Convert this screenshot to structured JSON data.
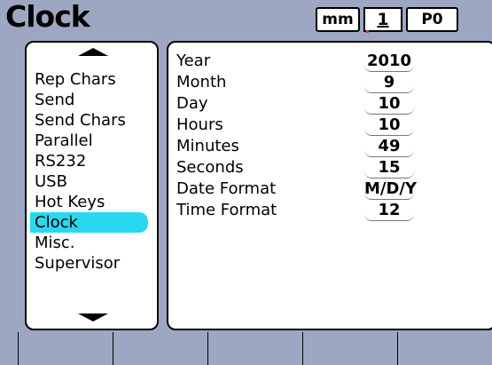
{
  "header": {
    "title": "Clock",
    "units": "mm",
    "channel": "1",
    "preset": "P0"
  },
  "menu": {
    "items": [
      {
        "label": "Rep  Chars"
      },
      {
        "label": "Send"
      },
      {
        "label": "Send  Chars"
      },
      {
        "label": "Parallel"
      },
      {
        "label": "RS232"
      },
      {
        "label": "USB"
      },
      {
        "label": "Hot  Keys"
      },
      {
        "label": "Clock",
        "selected": true
      },
      {
        "label": "Misc."
      },
      {
        "label": "Supervisor"
      }
    ],
    "selected_color": "#29d8ee"
  },
  "settings": {
    "rows": [
      {
        "label": "Year",
        "value": "2010"
      },
      {
        "label": "Month",
        "value": "9"
      },
      {
        "label": "Day",
        "value": "10"
      },
      {
        "label": "Hours",
        "value": "10"
      },
      {
        "label": "Minutes",
        "value": "49"
      },
      {
        "label": "Seconds",
        "value": "15"
      },
      {
        "label": "Date  Format",
        "value": "M/D/Y"
      },
      {
        "label": "Time  Format",
        "value": "12"
      }
    ]
  },
  "colors": {
    "background": "#9ea7c2",
    "panel": "#ffffff"
  }
}
